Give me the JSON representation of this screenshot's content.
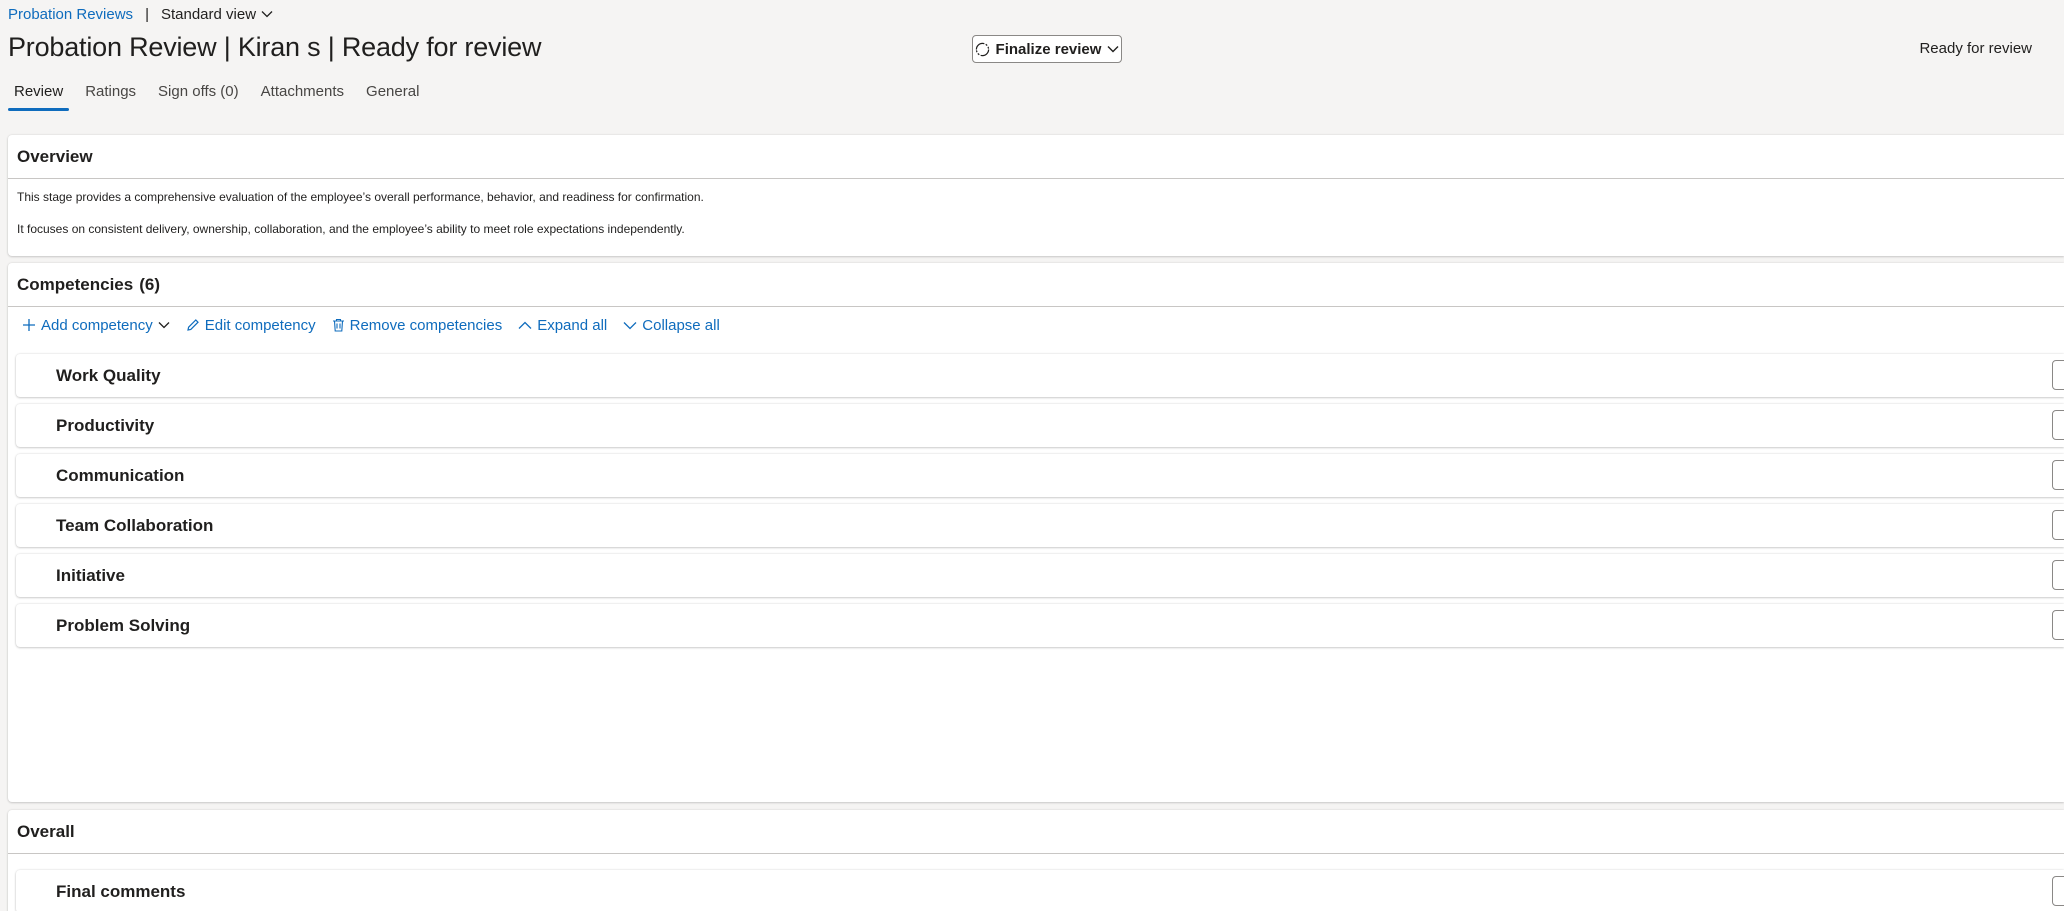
{
  "breadcrumb": {
    "parent": "Probation Reviews",
    "separator": "|",
    "view": "Standard view"
  },
  "header": {
    "title": "Probation Review | Kiran s | Ready for review",
    "finalize_label": "Finalize review",
    "status": "Ready for review"
  },
  "tabs": [
    {
      "label": "Review",
      "active": true
    },
    {
      "label": "Ratings",
      "active": false
    },
    {
      "label": "Sign offs (0)",
      "active": false
    },
    {
      "label": "Attachments",
      "active": false
    },
    {
      "label": "General",
      "active": false
    }
  ],
  "overview": {
    "title": "Overview",
    "para1": "This stage provides a comprehensive evaluation of the employee’s overall performance, behavior, and readiness for confirmation.",
    "para2": "It focuses on consistent delivery, ownership, collaboration, and the employee’s ability to meet role expectations independently."
  },
  "competencies": {
    "title": "Competencies",
    "count": "(6)",
    "toolbar": {
      "add": "Add competency",
      "edit": "Edit competency",
      "remove": "Remove competencies",
      "expand": "Expand all",
      "collapse": "Collapse all"
    },
    "items": [
      {
        "name": "Work Quality"
      },
      {
        "name": "Productivity"
      },
      {
        "name": "Communication"
      },
      {
        "name": "Team Collaboration"
      },
      {
        "name": "Initiative"
      },
      {
        "name": "Problem Solving"
      }
    ]
  },
  "overall": {
    "title": "Overall",
    "items": [
      {
        "name": "Final comments"
      }
    ]
  },
  "colors": {
    "accent": "#0f6cbd",
    "background": "#f5f4f3",
    "card": "#ffffff"
  }
}
